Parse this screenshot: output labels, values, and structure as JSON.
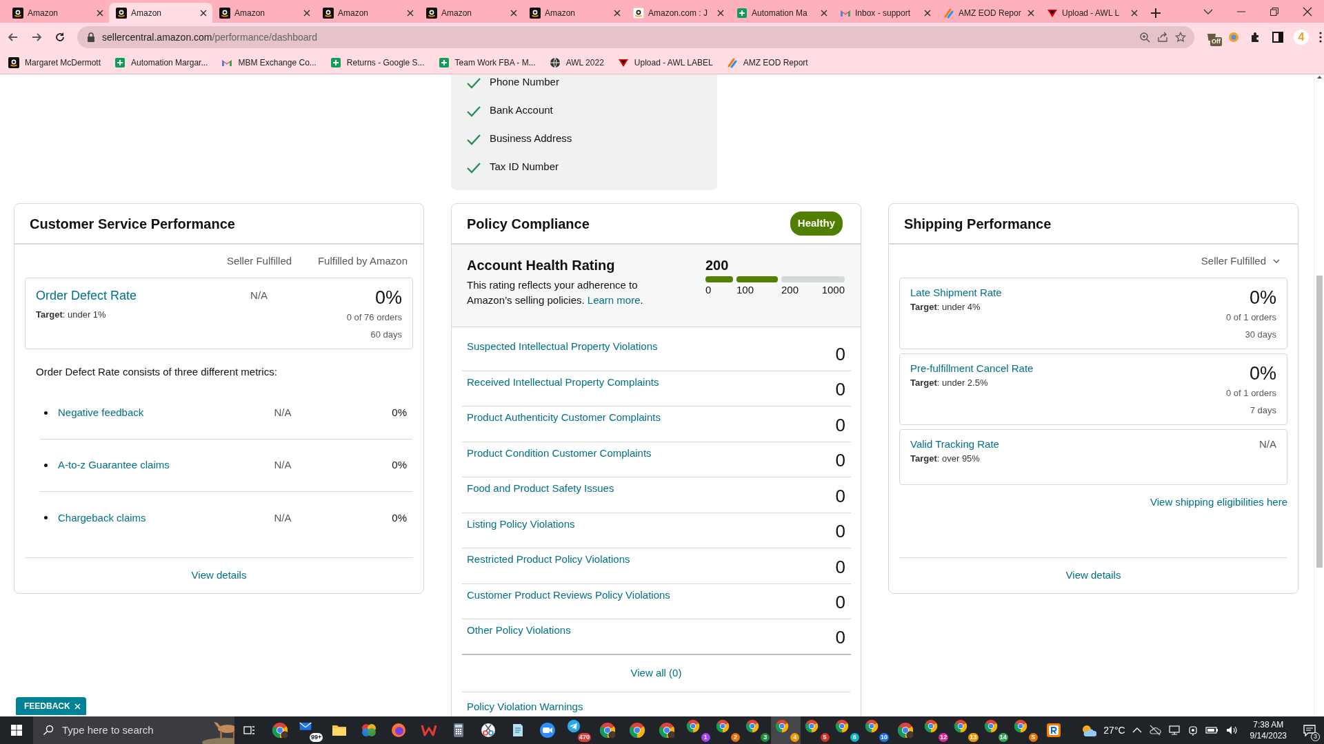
{
  "browser": {
    "tabs": [
      {
        "title": "Amazon",
        "selected": false
      },
      {
        "title": "Amazon",
        "selected": true
      },
      {
        "title": "Amazon",
        "selected": false
      },
      {
        "title": "Amazon",
        "selected": false
      },
      {
        "title": "Amazon",
        "selected": false
      },
      {
        "title": "Amazon",
        "selected": false
      },
      {
        "title": "Amazon.com : J",
        "selected": false
      },
      {
        "title": "Automation Ma",
        "selected": false
      },
      {
        "title": "Inbox - support",
        "selected": false
      },
      {
        "title": "AMZ EOD Repor",
        "selected": false
      },
      {
        "title": "Upload - AWL L",
        "selected": false
      }
    ],
    "url": {
      "host": "sellercentral.amazon.com",
      "path": "/performance/dashboard"
    },
    "extension_badge": "Off",
    "profile_badge": "4",
    "bookmarks": [
      {
        "label": "Margaret McDermott"
      },
      {
        "label": "Automation Margar..."
      },
      {
        "label": "MBM Exchange Co..."
      },
      {
        "label": "Returns - Google S..."
      },
      {
        "label": "Team Work FBA - M..."
      },
      {
        "label": "AWL 2022"
      },
      {
        "label": "Upload - AWL LABEL"
      },
      {
        "label": "AMZ EOD Report"
      }
    ]
  },
  "verification": {
    "items": [
      {
        "label": "Phone Number",
        "checked": true
      },
      {
        "label": "Bank Account",
        "checked": true
      },
      {
        "label": "Business Address",
        "checked": true
      },
      {
        "label": "Tax ID Number",
        "checked": true
      }
    ]
  },
  "customer_service": {
    "title": "Customer Service Performance",
    "columns": [
      "Seller Fulfilled",
      "Fulfilled by Amazon"
    ],
    "metric": {
      "name": "Order Defect Rate",
      "target": "**Target**: under 1%",
      "seller_fulfilled": "N/A",
      "value": "0%",
      "orders": "0 of 76 orders",
      "period": "60 days"
    },
    "note": "Order Defect Rate consists of three different metrics:",
    "sub_metrics": [
      {
        "name": "Negative feedback",
        "seller_fulfilled": "N/A",
        "fba": "0%"
      },
      {
        "name": "A-to-z Guarantee claims",
        "seller_fulfilled": "N/A",
        "fba": "0%"
      },
      {
        "name": "Chargeback claims",
        "seller_fulfilled": "N/A",
        "fba": "0%"
      }
    ],
    "details": "View details"
  },
  "policy": {
    "title": "Policy Compliance",
    "status": "Healthy",
    "rating": {
      "title": "Account Health Rating",
      "description": "This rating reflects your adherence to Amazon’s selling policies.",
      "link": "Learn more",
      "after_link": ".",
      "score": "200",
      "segments": [
        {
          "label": "0",
          "filled": true
        },
        {
          "label": "100",
          "filled": true
        },
        {
          "label": "200",
          "filled": false
        }
      ],
      "end_label": "1000"
    },
    "rows": [
      {
        "name": "Suspected Intellectual Property Violations",
        "count": "0"
      },
      {
        "name": "Received Intellectual Property Complaints",
        "count": "0"
      },
      {
        "name": "Product Authenticity Customer Complaints",
        "count": "0"
      },
      {
        "name": "Product Condition Customer Complaints",
        "count": "0"
      },
      {
        "name": "Food and Product Safety Issues",
        "count": "0"
      },
      {
        "name": "Listing Policy Violations",
        "count": "0"
      },
      {
        "name": "Restricted Product Policy Violations",
        "count": "0"
      },
      {
        "name": "Customer Product Reviews Policy Violations",
        "count": "0"
      },
      {
        "name": "Other Policy Violations",
        "count": "0"
      }
    ],
    "view_all": "View all (0)",
    "next_section": "Policy Violation Warnings"
  },
  "shipping": {
    "title": "Shipping Performance",
    "filter": "Seller Fulfilled",
    "metrics": [
      {
        "kind": "rate",
        "name": "Late Shipment Rate",
        "target": "**Target**: under 4%",
        "value": "0%",
        "orders": "0 of 1 orders",
        "period": "30 days"
      },
      {
        "kind": "rate",
        "name": "Pre-fulfillment Cancel Rate",
        "target": "**Target**: under 2.5%",
        "value": "0%",
        "orders": "0 of 1 orders",
        "period": "7 days"
      },
      {
        "kind": "na",
        "name": "Valid Tracking Rate",
        "target": "**Target**: over 95%",
        "value": "N/A"
      }
    ],
    "link": "View shipping eligibilities here",
    "details": "View details"
  },
  "feedback": {
    "label": "FEEDBACK"
  },
  "taskbar": {
    "search_placeholder": "Type here to search",
    "apps": [
      {
        "kind": "chrome-profile",
        "selected": false
      },
      {
        "kind": "mail",
        "badge": "99+",
        "selected": false
      },
      {
        "kind": "folder",
        "selected": false
      },
      {
        "kind": "photos",
        "selected": false
      },
      {
        "kind": "firefox",
        "selected": false
      },
      {
        "kind": "wps",
        "selected": false
      },
      {
        "kind": "calculator",
        "selected": false
      },
      {
        "kind": "snip",
        "selected": false
      },
      {
        "kind": "notepad",
        "selected": false
      },
      {
        "kind": "zoom",
        "selected": false
      },
      {
        "kind": "telegram",
        "badge": "470",
        "selected": false
      },
      {
        "kind": "chrome-profile",
        "selected": false
      },
      {
        "kind": "chrome",
        "selected": false
      },
      {
        "kind": "chrome-profile",
        "selected": false
      },
      {
        "kind": "chrome",
        "badge": "1",
        "color": "#a142f4",
        "selected": false
      },
      {
        "kind": "chrome",
        "badge": "2",
        "color": "#e8710a",
        "selected": false
      },
      {
        "kind": "chrome",
        "badge": "3",
        "color": "#1e8e3e",
        "selected": false
      },
      {
        "kind": "chrome",
        "badge": "4",
        "color": "#f29900",
        "selected": true
      },
      {
        "kind": "chrome",
        "badge": "5",
        "color": "#d93025",
        "selected": false
      },
      {
        "kind": "chrome",
        "badge": "6",
        "color": "#12b5cb",
        "selected": false
      },
      {
        "kind": "chrome",
        "badge": "10",
        "color": "#1a73e8",
        "selected": false
      },
      {
        "kind": "chrome-profile",
        "selected": false
      },
      {
        "kind": "chrome",
        "badge": "12",
        "color": "#e52592",
        "selected": false
      },
      {
        "kind": "chrome",
        "badge": "13",
        "color": "#f29900",
        "selected": false
      },
      {
        "kind": "chrome",
        "badge": "14",
        "color": "#34a853",
        "selected": false
      },
      {
        "kind": "chrome",
        "badge": "S",
        "color": "#e8710a",
        "selected": false
      },
      {
        "kind": "r-app",
        "selected": false
      }
    ],
    "weather": "27°C",
    "time": "7:38 AM",
    "date": "9/14/2023",
    "notifications": "3"
  }
}
